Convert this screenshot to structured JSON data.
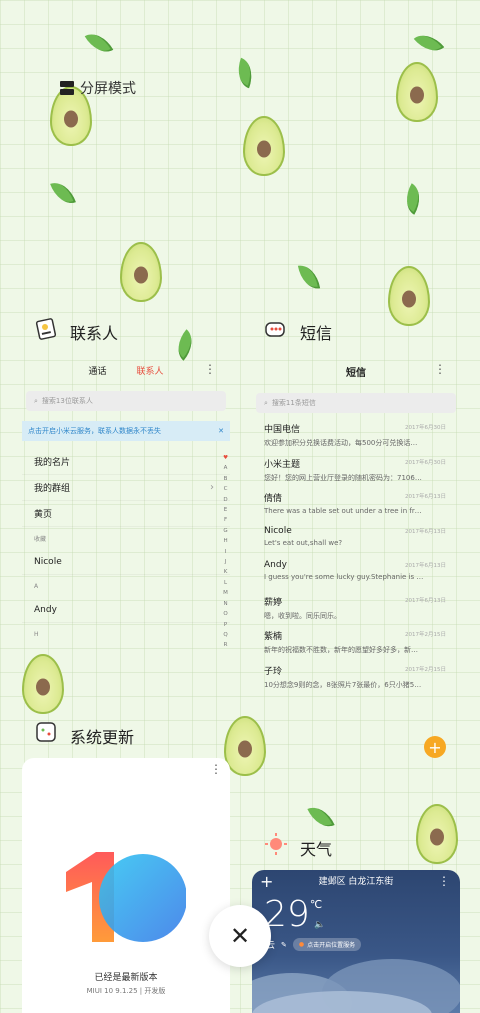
{
  "split_screen": {
    "label": "分屏模式"
  },
  "contacts": {
    "title": "联系人",
    "tabs": [
      "通话",
      "联系人"
    ],
    "active_tab": 1,
    "search_placeholder": "搜索13位联系人",
    "banner_text": "点击开启小米云服务，联系人数据永不丢失",
    "banner_close": "✕",
    "rows": [
      {
        "type": "item",
        "label": "我的名片"
      },
      {
        "type": "item",
        "label": "我的群组",
        "chevron": "›"
      },
      {
        "type": "item",
        "label": "黄页"
      },
      {
        "type": "header",
        "label": "收藏"
      },
      {
        "type": "item",
        "label": "Nicole"
      },
      {
        "type": "header",
        "label": "A"
      },
      {
        "type": "item",
        "label": "Andy"
      },
      {
        "type": "header",
        "label": "H"
      }
    ],
    "alphabet": [
      "♥",
      "A",
      "B",
      "C",
      "D",
      "E",
      "F",
      "G",
      "H",
      "I",
      "J",
      "K",
      "L",
      "M",
      "N",
      "O",
      "P",
      "Q",
      "R"
    ]
  },
  "sms": {
    "title": "短信",
    "header": "短信",
    "search_placeholder": "搜索11条短信",
    "messages": [
      {
        "name": "中国电信",
        "preview": "欢迎参加积分兑换话费活动，每500分可兑换话费5元…",
        "date": "2017年6月30日"
      },
      {
        "name": "小米主题",
        "preview": "您好！您的网上营业厅登录的随机密码为：710679…",
        "date": "2017年6月30日"
      },
      {
        "name": "倩倩",
        "preview": "There was a table set out under a tree in front of …",
        "date": "2017年6月13日"
      },
      {
        "name": "Nicole",
        "preview": "Let's eat out,shall we?",
        "date": "2017年6月13日"
      },
      {
        "name": "Andy",
        "preview": "I guess you're some lucky guy.Stephanie is a ni…",
        "date": "2017年6月13日"
      },
      {
        "name": "薪婷",
        "preview": "嗯，收到啦。同乐同乐。",
        "date": "2017年6月13日"
      },
      {
        "name": "紫楠",
        "preview": "新年的祝福数不胜数，新年的愿望好多好多，新年…",
        "date": "2017年2月15日"
      },
      {
        "name": "子玲",
        "preview": "10分想念9则的念，8张照片7张最价，6只小猪5只…",
        "date": "2017年2月15日"
      }
    ],
    "fab": "+"
  },
  "system_update": {
    "title": "系统更新",
    "status": "已经是最新版本",
    "version": "MIUI 10 9.1.25 | 开发版"
  },
  "weather": {
    "title": "天气",
    "location": "建邺区 白龙江东街",
    "temperature": "29",
    "unit": "℃",
    "condition": "云",
    "voice_hint": "点击开启位置服务",
    "add": "+"
  },
  "close_button": {
    "label": "✕"
  },
  "colors": {
    "accent_red": "#e74c3c",
    "fab_orange": "#f7a823",
    "banner_blue": "#2f86c9",
    "leaf_green": "#6dbb52"
  }
}
